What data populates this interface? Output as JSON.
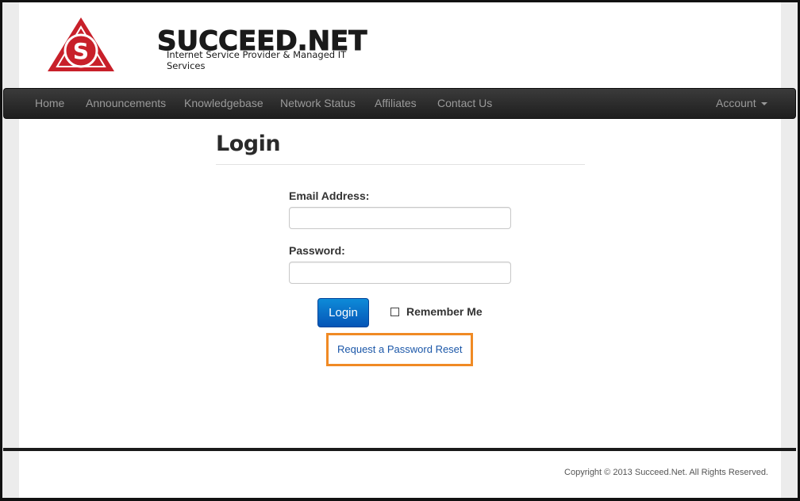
{
  "brand": {
    "name": "SUCCEED.NET",
    "tagline": "Internet Service Provider & Managed IT Services",
    "accent": "#c8202a"
  },
  "nav": {
    "items": [
      {
        "label": "Home"
      },
      {
        "label": "Announcements"
      },
      {
        "label": "Knowledgebase"
      },
      {
        "label": "Network Status"
      },
      {
        "label": "Affiliates"
      },
      {
        "label": "Contact Us"
      }
    ],
    "account_label": "Account"
  },
  "login": {
    "title": "Login",
    "email_label": "Email Address:",
    "email_value": "",
    "password_label": "Password:",
    "password_value": "",
    "submit_label": "Login",
    "remember_label": "Remember Me",
    "remember_checked": false,
    "reset_link": "Request a Password Reset"
  },
  "footer": {
    "copyright": "Copyright © 2013 Succeed.Net. All Rights Reserved."
  },
  "colors": {
    "highlight": "#f08a24",
    "button": "#0a6fcc",
    "link": "#1b57a8"
  }
}
